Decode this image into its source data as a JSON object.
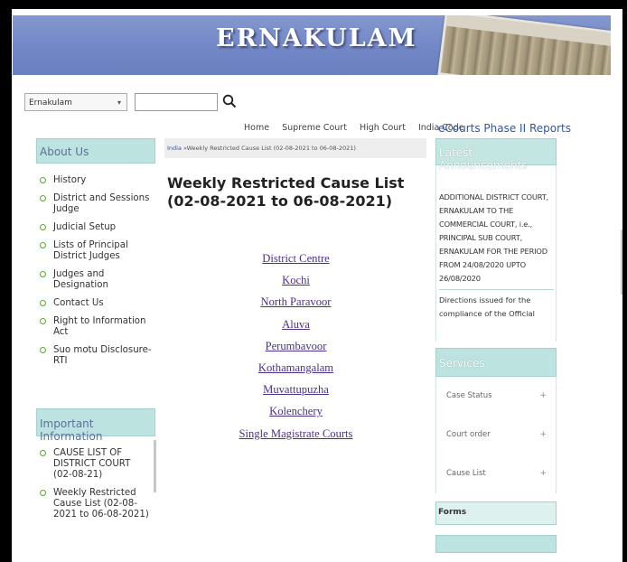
{
  "banner": {
    "title": "ERNAKULAM"
  },
  "search": {
    "district_value": "Ernakulam",
    "query": ""
  },
  "topnav": {
    "items": [
      "Home",
      "Supreme Court",
      "High Court",
      "India Code"
    ],
    "ecourts": "eCourts Phase II Reports"
  },
  "about": {
    "heading": "About Us",
    "items": [
      "History",
      "District and Sessions Judge",
      "Judicial Setup",
      "Lists of Principal District Judges",
      "Judges and Designation",
      "Contact Us",
      "Right to Information Act",
      "Suo motu Disclosure-RTI"
    ]
  },
  "important": {
    "heading": "Important Information",
    "items": [
      "CAUSE LIST OF DISTRICT COURT (02-08-21)",
      "Weekly Restricted Cause List (02-08-2021 to 06-08-2021)"
    ]
  },
  "breadcrumb": {
    "root": "India",
    "current": "Weekly Restricted Cause List (02-08-2021 to 06-08-2021)"
  },
  "main": {
    "title_line1": "Weekly Restricted Cause List",
    "title_line2": "(02-08-2021 to 06-08-2021)",
    "links": [
      "District Centre",
      "Kochi",
      "North Paravoor",
      "Aluva",
      "Perumbavoor",
      "Kothamangalam",
      "Muvattupuzha",
      "Kolenchery",
      "Single Magistrate Courts"
    ]
  },
  "latest": {
    "heading": "Latest Announcements",
    "items": [
      "ADDITIONAL DISTRICT COURT, ERNAKULAM TO THE COMMERCIAL COURT, i.e., PRINCIPAL SUB COURT, ERNAKULAM FOR THE PERIOD FROM 24/08/2020 UPTO 26/08/2020",
      "Directions issued for the compliance of the Official"
    ]
  },
  "services": {
    "heading": "Services",
    "items": [
      {
        "label": "Case Status",
        "toggle": "+"
      },
      {
        "label": "Court order",
        "toggle": "+"
      },
      {
        "label": "Cause List",
        "toggle": "+"
      }
    ]
  },
  "forms": {
    "heading": "Forms"
  },
  "colors": {
    "banner": "#7287c6",
    "box_heading": "#bde3e1",
    "link_purple": "#4b2f8e",
    "link_blue": "#2e56a8",
    "bullet_green": "#5fa13f"
  }
}
